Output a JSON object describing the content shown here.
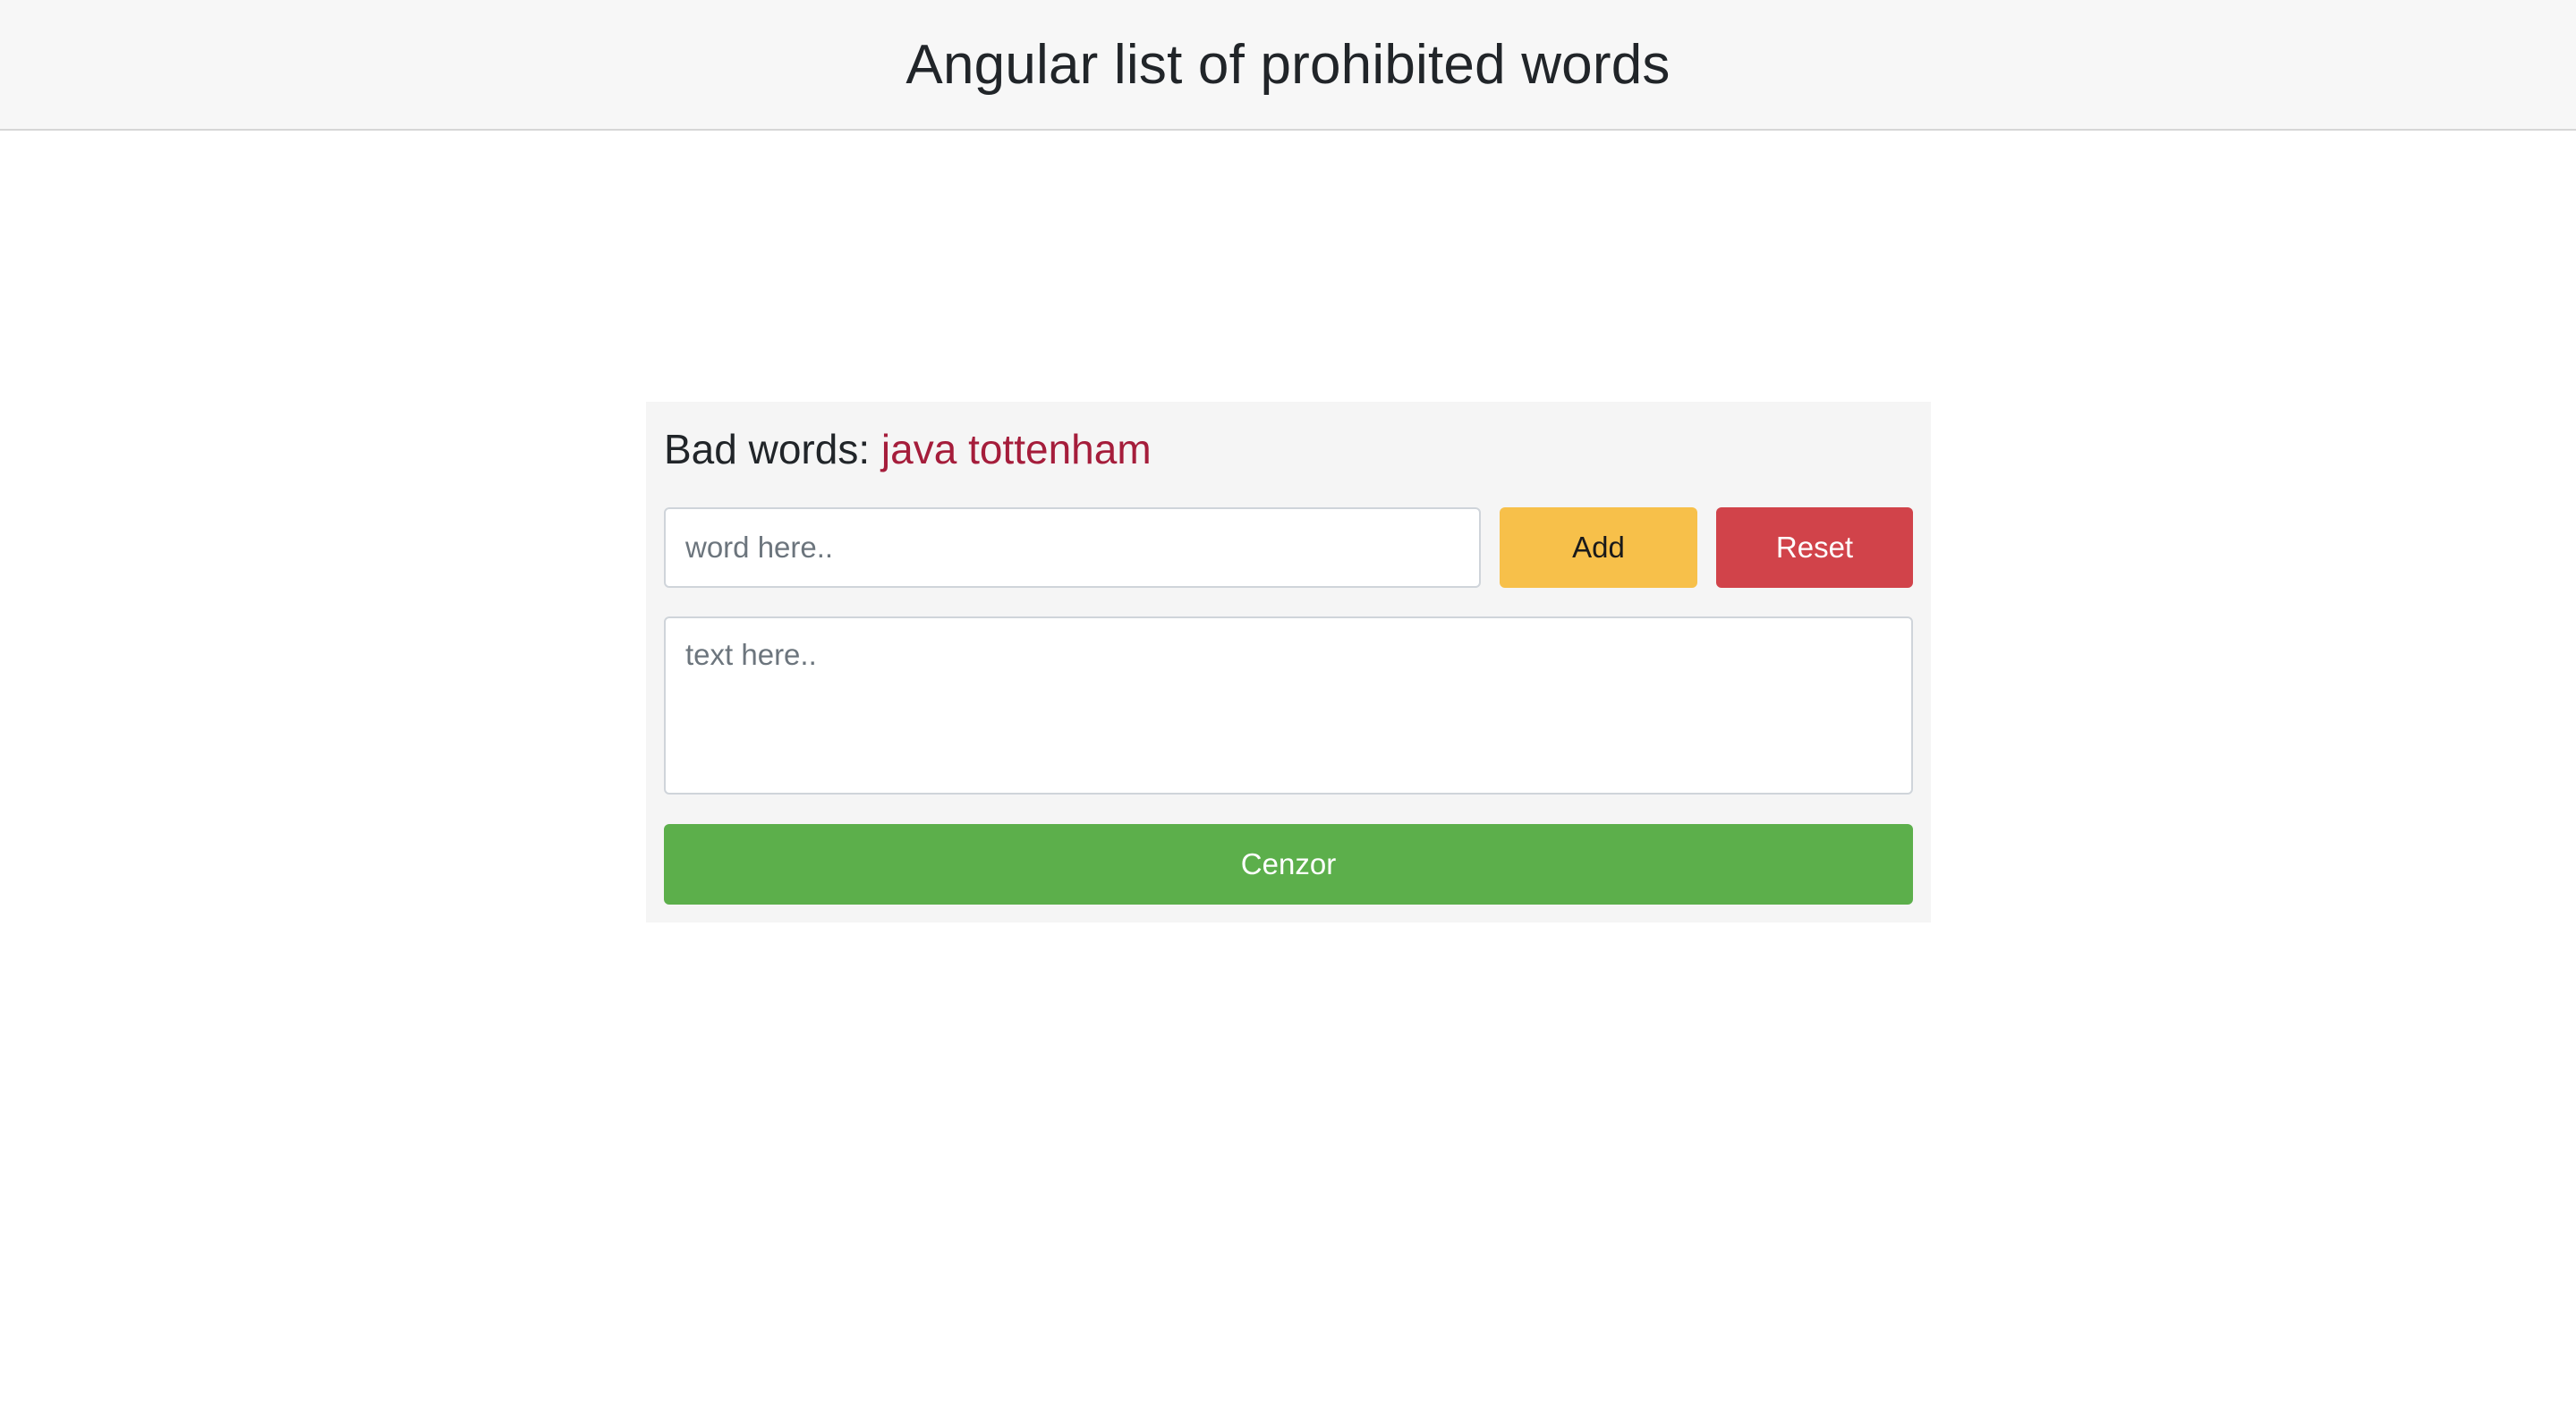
{
  "header": {
    "title": "Angular list of prohibited words"
  },
  "panel": {
    "bad_words_label": "Bad words:",
    "bad_words_list": "java tottenham",
    "word_input": {
      "value": "",
      "placeholder": "word here.."
    },
    "add_label": "Add",
    "reset_label": "Reset",
    "text_area": {
      "value": "",
      "placeholder": "text here.."
    },
    "cenzor_label": "Cenzor"
  },
  "colors": {
    "header_bg": "#f7f7f7",
    "panel_bg": "#f5f5f5",
    "bad_words_accent": "#a51d3b",
    "add_button": "#f7c04a",
    "reset_button": "#d1434a",
    "cenzor_button": "#5caf4b"
  }
}
